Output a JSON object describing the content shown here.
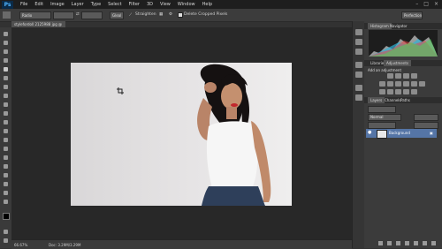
{
  "app": {
    "logo": "Ps"
  },
  "menu": [
    "File",
    "Edit",
    "Image",
    "Layer",
    "Type",
    "Select",
    "Filter",
    "3D",
    "View",
    "Window",
    "Help"
  ],
  "window_controls": [
    "–",
    "□",
    "×"
  ],
  "options_bar": {
    "mode_value": "Radio",
    "opacity_value": "Gleal",
    "straighten_label": "Straighten",
    "delete_cropped_label": "Delete Cropped Pixels",
    "workspace_value": "Perfection"
  },
  "document": {
    "tab_label": "stylefordoll 2125988 jpg @ 66.7% (RGB/8)"
  },
  "status": {
    "zoom": "66.67%",
    "doc_info": "Doc: 3.29M/3.29M"
  },
  "panels": {
    "histogram_tabs": [
      "Histogram",
      "Navigator"
    ],
    "adjust_tabs": [
      "Libraries",
      "Adjustments"
    ],
    "adjust_title": "Add an adjustment",
    "layer_tabs": [
      "Layers",
      "Channels",
      "Paths"
    ],
    "blend_mode": "Normal",
    "layer_name": "Background"
  },
  "colors": {
    "accent": "#4fb4ff",
    "selection": "#5575a6"
  }
}
